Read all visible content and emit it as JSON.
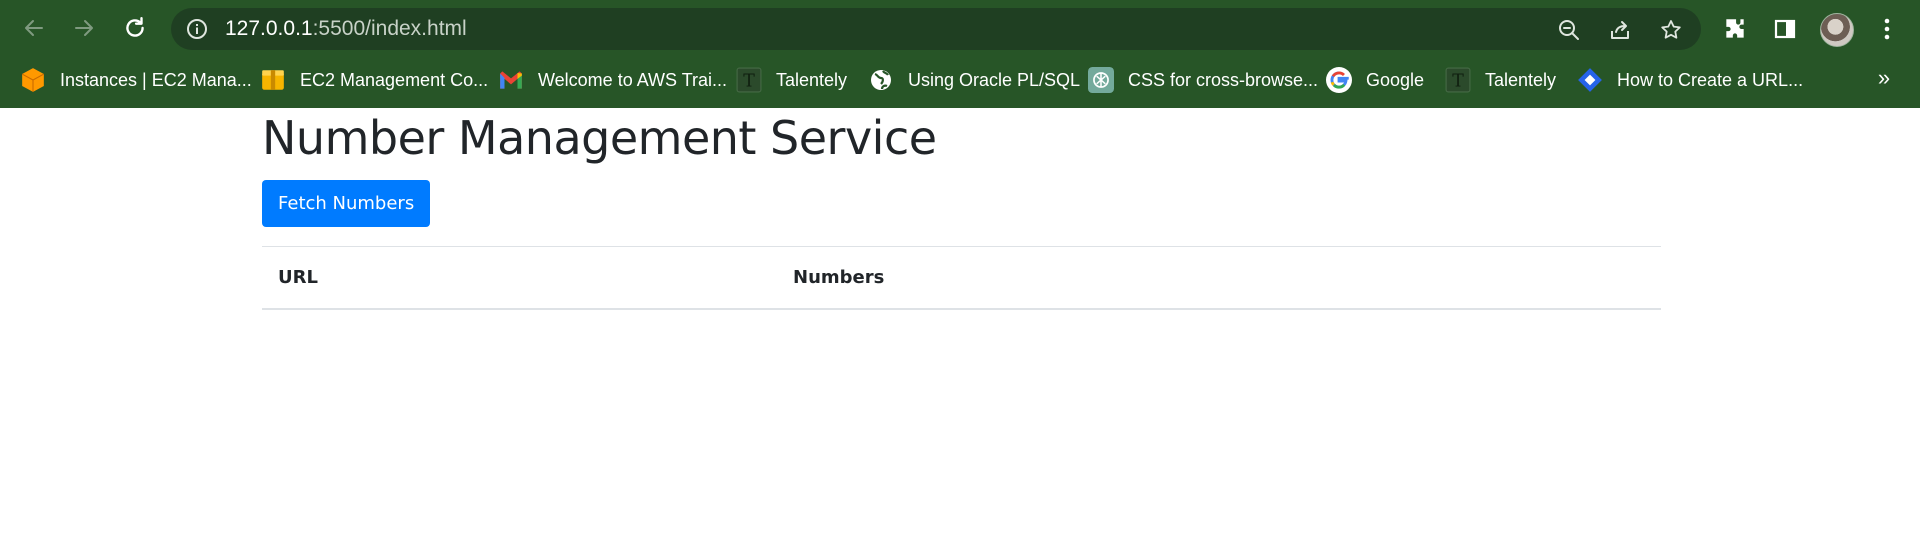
{
  "browser": {
    "address": {
      "host": "127.0.0.1",
      "path": ":5500/index.html"
    },
    "bookmarks": [
      {
        "label": "Instances | EC2 Mana...",
        "icon": "aws-orange-icon",
        "color": "#ff9900"
      },
      {
        "label": "EC2 Management Co...",
        "icon": "aws-box-icon",
        "color": "#f7b500"
      },
      {
        "label": "Welcome to AWS Trai...",
        "icon": "gmail-icon",
        "color": "#ea4335"
      },
      {
        "label": "Talentely",
        "icon": "talentely-icon",
        "color": "#2b3b2b"
      },
      {
        "label": "Using Oracle PL/SQL",
        "icon": "globe-icon",
        "color": "#ffffff"
      },
      {
        "label": "CSS for cross-browse...",
        "icon": "chatgpt-icon",
        "color": "#74aa9c"
      },
      {
        "label": "Google",
        "icon": "google-icon",
        "color": "#4285f4"
      },
      {
        "label": "Talentely",
        "icon": "talentely-icon",
        "color": "#2b3b2b"
      },
      {
        "label": "How to Create a URL...",
        "icon": "diamond-icon",
        "color": "#2563eb"
      }
    ],
    "more_bookmarks": "»"
  },
  "page": {
    "title": "Number Management Service",
    "fetch_button": "Fetch Numbers",
    "table": {
      "columns": [
        "URL",
        "Numbers"
      ],
      "rows": []
    }
  },
  "colors": {
    "browser_frame": "#275527",
    "primary_button": "#007bff",
    "text": "#212529"
  }
}
